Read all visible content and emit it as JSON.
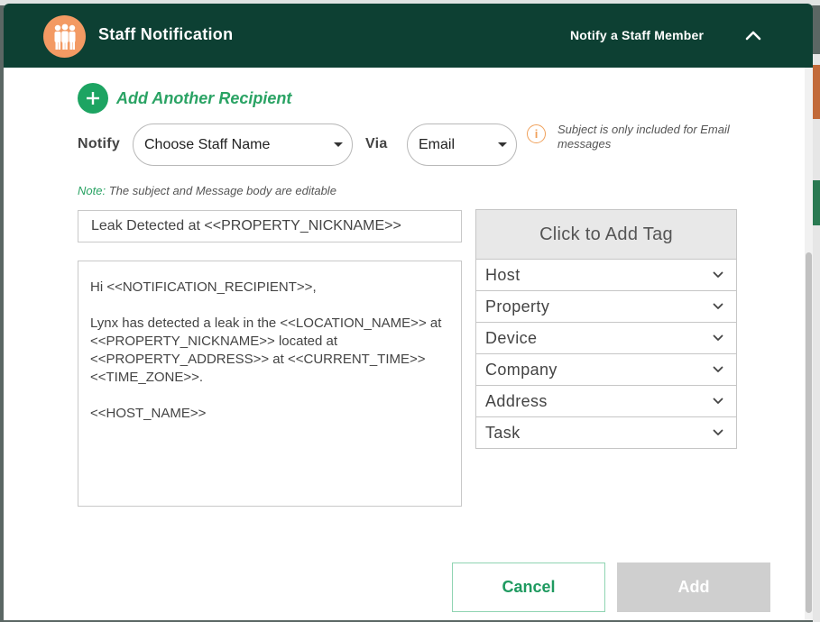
{
  "header": {
    "title": "Staff Notification",
    "subtitle": "Notify a Staff Member",
    "logo_icon": "staff-group-icon",
    "collapse_icon": "chevron-up-icon"
  },
  "add_recipient": {
    "label": "Add Another Recipient",
    "icon": "plus-icon"
  },
  "notify": {
    "label": "Notify",
    "value": "Choose Staff Name"
  },
  "via": {
    "label": "Via",
    "value": "Email"
  },
  "info": {
    "icon": "info-icon",
    "text": "Subject is only included for Email messages"
  },
  "note": {
    "prefix": "Note:",
    "text": "The subject and Message body are editable"
  },
  "subject": {
    "value": "Leak Detected at <<PROPERTY_NICKNAME>>"
  },
  "message": {
    "greeting": "Hi <<NOTIFICATION_RECIPIENT>>,",
    "body": "Lynx has detected a leak in the <<LOCATION_NAME>> at <<PROPERTY_NICKNAME>> located at <<PROPERTY_ADDRESS>> at <<CURRENT_TIME>> <<TIME_ZONE>>.",
    "signature": "<<HOST_NAME>>"
  },
  "tags": {
    "header": "Click to Add Tag",
    "items": [
      {
        "label": "Host"
      },
      {
        "label": "Property"
      },
      {
        "label": "Device"
      },
      {
        "label": "Company"
      },
      {
        "label": "Address"
      },
      {
        "label": "Task"
      }
    ]
  },
  "actions": {
    "cancel": "Cancel",
    "add": "Add"
  },
  "colors": {
    "header_bg": "#0d4033",
    "accent_green": "#1da462",
    "logo_orange": "#f39a63",
    "info_orange": "#f0a05a",
    "disabled_gray": "#cfcfcf"
  }
}
